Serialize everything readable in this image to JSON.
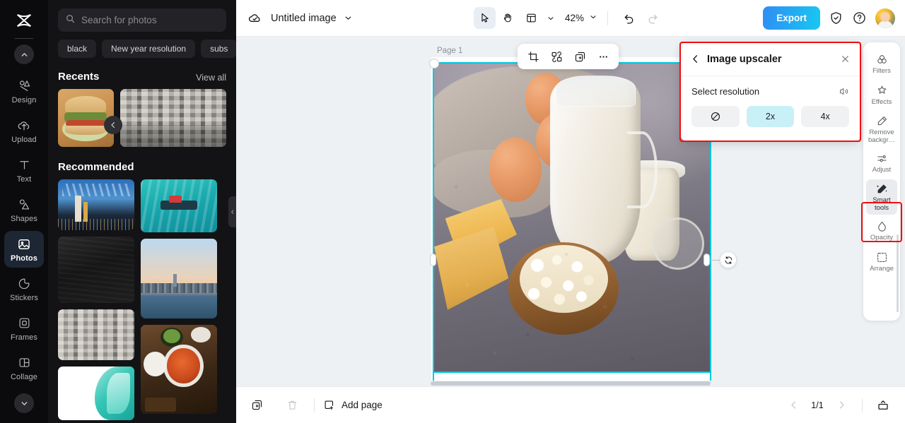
{
  "app": {
    "brand_icon": "capcut-logo-icon",
    "accent_cyan": "#00c8e0",
    "highlight_red": "#f20d0d",
    "export_gradient_from": "#2f8df5",
    "export_gradient_to": "#18c8f0"
  },
  "rail": {
    "collapse_icon": "chevron-up-icon",
    "expand_icon": "chevron-down-icon",
    "items": [
      {
        "label": "Design",
        "icon": "design-icon",
        "active": false
      },
      {
        "label": "Upload",
        "icon": "upload-cloud-icon",
        "active": false
      },
      {
        "label": "Text",
        "icon": "text-icon",
        "active": false
      },
      {
        "label": "Shapes",
        "icon": "shapes-icon",
        "active": false
      },
      {
        "label": "Photos",
        "icon": "photos-icon",
        "active": true
      },
      {
        "label": "Stickers",
        "icon": "sticker-icon",
        "active": false
      },
      {
        "label": "Frames",
        "icon": "frames-icon",
        "active": false
      },
      {
        "label": "Collage",
        "icon": "collage-icon",
        "active": false
      }
    ]
  },
  "panel": {
    "search": {
      "placeholder": "Search for photos",
      "value": "",
      "icon": "search-icon"
    },
    "tags": [
      "black",
      "New year resolution",
      "subs"
    ],
    "recents": {
      "title": "Recents",
      "view_all": "View all",
      "prev_icon": "chevron-left-icon"
    },
    "recommended": {
      "title": "Recommended"
    },
    "collapse_icon": "chevron-left-icon"
  },
  "topbar": {
    "cloud_icon": "cloud-saved-icon",
    "doc_title": "Untitled image",
    "title_caret_icon": "chevron-down-icon",
    "tools": [
      {
        "name": "select-tool",
        "icon": "cursor-arrow-icon",
        "selected": true
      },
      {
        "name": "hand-tool",
        "icon": "hand-icon",
        "selected": false
      },
      {
        "name": "layout-tool",
        "icon": "layout-icon",
        "selected": false
      }
    ],
    "layout_caret_icon": "chevron-down-icon",
    "zoom_level": "42%",
    "zoom_caret_icon": "chevron-down-icon",
    "undo_icon": "undo-icon",
    "redo_icon": "redo-icon",
    "export_label": "Export",
    "shield_icon": "shield-check-icon",
    "help_icon": "help-circle-icon",
    "avatar_icon": "user-avatar"
  },
  "canvas": {
    "page_label": "Page 1",
    "floating_toolbar": [
      {
        "name": "crop-button",
        "icon": "crop-icon"
      },
      {
        "name": "cutout-button",
        "icon": "cutout-icon"
      },
      {
        "name": "duplicate-button",
        "icon": "duplicate-icon"
      },
      {
        "name": "more-button",
        "icon": "ellipsis-icon"
      }
    ],
    "rotate_icon": "rotate-icon",
    "image_alt": "dairy products: eggs, milk jug, cheese wedges, cottage cheese bowl, cream jar on stone surface"
  },
  "upscaler": {
    "back_icon": "chevron-left-icon",
    "title": "Image upscaler",
    "close_icon": "close-icon",
    "section_label": "Select resolution",
    "compare_icon": "compare-icon",
    "options": [
      {
        "label": "",
        "icon": "none-forbidden-icon",
        "selected": false
      },
      {
        "label": "2x",
        "icon": "",
        "selected": true
      },
      {
        "label": "4x",
        "icon": "",
        "selected": false
      }
    ]
  },
  "right_rail": {
    "items": [
      {
        "label": "Filters",
        "icon": "filters-icon",
        "active": false
      },
      {
        "label": "Effects",
        "icon": "effects-icon",
        "active": false
      },
      {
        "label": "Remove backgr…",
        "icon": "remove-bg-icon",
        "active": false
      },
      {
        "label": "Adjust",
        "icon": "adjust-icon",
        "active": false
      },
      {
        "label": "Smart tools",
        "icon": "smart-tools-icon",
        "active": true
      },
      {
        "label": "Opacity",
        "icon": "opacity-icon",
        "active": false
      },
      {
        "label": "Arrange",
        "icon": "arrange-icon",
        "active": false
      }
    ]
  },
  "bottombar": {
    "duplicate_page_icon": "duplicate-page-icon",
    "delete_page_icon": "trash-icon",
    "add_page_label": "Add page",
    "add_page_icon": "add-square-icon",
    "prev_icon": "chevron-left-icon",
    "page_indicator": "1/1",
    "next_icon": "chevron-right-icon",
    "grid_view_icon": "page-view-icon"
  }
}
